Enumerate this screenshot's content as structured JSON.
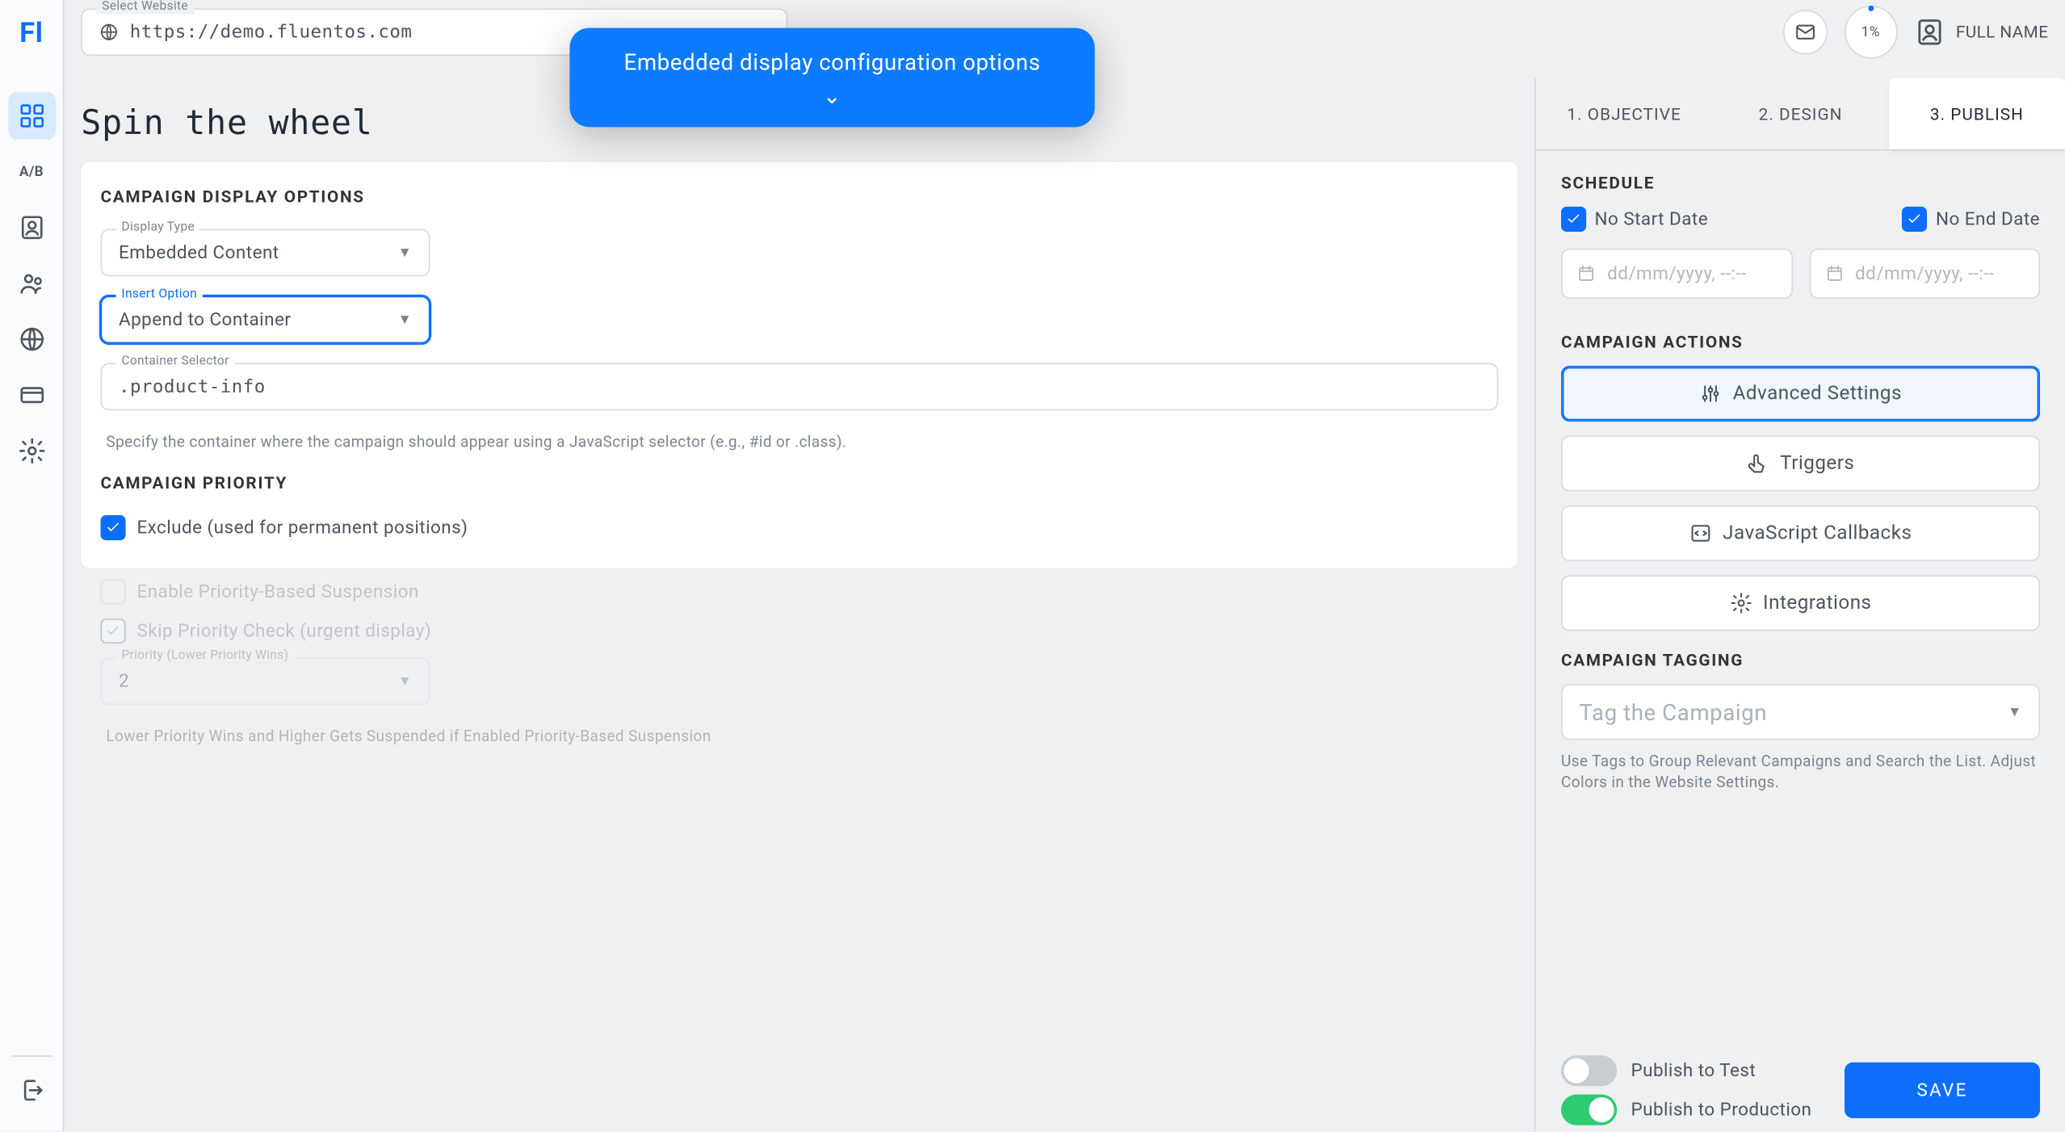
{
  "selectWebsite": {
    "label": "Select Website",
    "value": "https://demo.fluentos.com"
  },
  "tooltip": {
    "text": "Embedded display configuration options"
  },
  "user": {
    "pct": "1%",
    "name": "FULL NAME"
  },
  "pageTitle": "Spin the wheel",
  "displayOptions": {
    "heading": "CAMPAIGN DISPLAY OPTIONS",
    "displayType": {
      "label": "Display Type",
      "value": "Embedded Content"
    },
    "insertOption": {
      "label": "Insert Option",
      "value": "Append to Container"
    },
    "containerSelector": {
      "label": "Container Selector",
      "value": ".product-info"
    },
    "helper": "Specify the container where the campaign should appear using a JavaScript selector (e.g., #id or .class)."
  },
  "priority": {
    "heading": "CAMPAIGN PRIORITY",
    "exclude": "Exclude (used for permanent positions)",
    "enable": "Enable Priority-Based Suspension",
    "skip": "Skip Priority Check (urgent display)",
    "level": {
      "label": "Priority (Lower Priority Wins)",
      "value": "2"
    },
    "helper": "Lower Priority Wins and Higher Gets Suspended if Enabled Priority-Based Suspension"
  },
  "steps": {
    "one": "1. OBJECTIVE",
    "two": "2. DESIGN",
    "three": "3. PUBLISH"
  },
  "schedule": {
    "heading": "SCHEDULE",
    "noStart": "No Start Date",
    "noEnd": "No End Date",
    "placeholder": "dd/mm/yyyy, --:--"
  },
  "actions": {
    "heading": "CAMPAIGN ACTIONS",
    "advanced": "Advanced Settings",
    "triggers": "Triggers",
    "js": "JavaScript Callbacks",
    "integrations": "Integrations"
  },
  "tagging": {
    "heading": "CAMPAIGN TAGGING",
    "placeholder": "Tag the Campaign",
    "hint": "Use Tags to Group Relevant Campaigns and Search the List. Adjust Colors in the Website Settings."
  },
  "footer": {
    "test": "Publish to Test",
    "prod": "Publish to Production",
    "save": "SAVE"
  }
}
